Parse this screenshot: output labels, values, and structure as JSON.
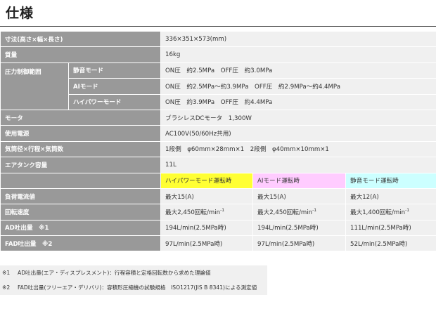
{
  "title": "仕様",
  "rows": {
    "size": {
      "label": "寸法(高さ×幅×長さ)",
      "value": "336×351×573(mm)"
    },
    "weight": {
      "label": "質量",
      "value": "16kg"
    },
    "pressure": {
      "label": "圧力制御範囲",
      "quiet": {
        "label": "静音モード",
        "value": "ON圧　約2.5MPa　OFF圧　約3.0MPa"
      },
      "ai": {
        "label": "AIモード",
        "value": "ON圧　約2.5MPa～約3.9MPa　OFF圧　約2.9MPa～約4.4MPa"
      },
      "hipower": {
        "label": "ハイパワーモード",
        "value": "ON圧　約3.9MPa　OFF圧　約4.4MPa"
      }
    },
    "motor": {
      "label": "モータ",
      "value": "ブラシレスDCモータ　1,300W"
    },
    "power": {
      "label": "使用電源",
      "value": "AC100V(50/60Hz共用)"
    },
    "cylinder": {
      "label": "気筒径×行程×気筒数",
      "value": "1段側　φ60mm×28mm×1　2段側　φ40mm×10mm×1"
    },
    "tank": {
      "label": "エアタンク容量",
      "value": "11L"
    }
  },
  "mode_headers": [
    "ハイパワーモード運転時",
    "AIモード運転時",
    "静音モード運転時"
  ],
  "mode_rows": [
    {
      "label": "負荷電流値",
      "values": [
        "最大15(A)",
        "最大15(A)",
        "最大12(A)"
      ]
    },
    {
      "label": "回転速度",
      "values": [
        "最大2,450回転/min",
        "最大2,450回転/min",
        "最大1,400回転/min"
      ],
      "sup": "-1"
    },
    {
      "label": "AD吐出量　※1",
      "values": [
        "194L/min(2.5MPa時)",
        "194L/min(2.5MPa時)",
        "111L/min(2.5MPa時)"
      ]
    },
    {
      "label": "FAD吐出量　※2",
      "values": [
        "97L/min(2.5MPa時)",
        "97L/min(2.5MPa時)",
        "52L/min(2.5MPa時)"
      ]
    }
  ],
  "notes": [
    {
      "mark": "※1",
      "text": "AD吐出量(エア・ディスプレスメント)：行程容積と定格回転数から求めた理論値"
    },
    {
      "mark": "※2",
      "text": "FAD吐出量(フリーエア・デリバリ)：容積形圧縮機の試験規格　ISO1217(JIS B 8341)による測定値"
    }
  ],
  "colors": {
    "label_bg": "#999999",
    "value_bg": "#f0f0f0",
    "hipower_header": "#ffff33",
    "ai_header": "#ffccff",
    "quiet_header": "#ccffff"
  }
}
